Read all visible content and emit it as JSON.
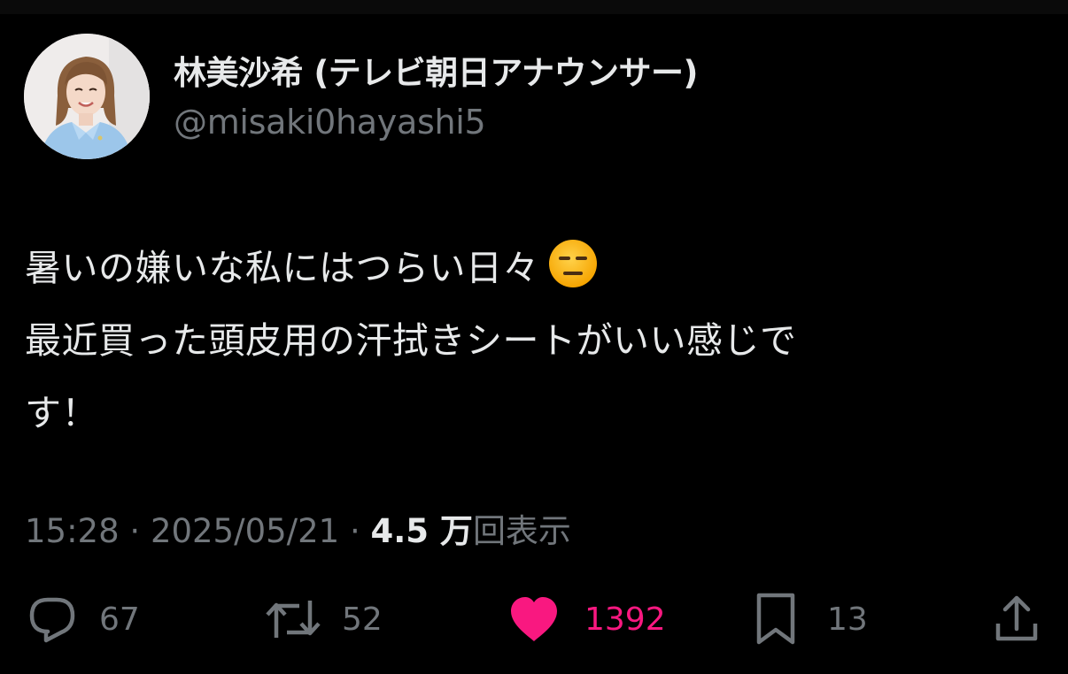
{
  "user": {
    "display_name": "林美沙希 (テレビ朝日アナウンサー)",
    "handle": "@misaki0hayashi5",
    "avatar_icon": "profile-photo"
  },
  "tweet": {
    "lines": [
      "暑いの嫌いな私にはつらい日々",
      "最近買った頭皮用の汗拭きシートがいい感じで",
      "す！"
    ],
    "emoji": "expressionless-face-emoji"
  },
  "meta": {
    "time": "15:28",
    "separator": "·",
    "date": "2025/05/21",
    "views_count": "4.5 万",
    "views_label": "回表示"
  },
  "actions": {
    "reply": {
      "icon": "reply-icon",
      "count": "67"
    },
    "retweet": {
      "icon": "retweet-icon",
      "count": "52"
    },
    "like": {
      "icon": "heart-icon",
      "count": "1392",
      "active": true
    },
    "bookmark": {
      "icon": "bookmark-icon",
      "count": "13"
    },
    "share": {
      "icon": "share-icon"
    }
  },
  "colors": {
    "background": "#000000",
    "text_primary": "#e7e9ea",
    "text_secondary": "#71767b",
    "like_active": "#f91880"
  }
}
